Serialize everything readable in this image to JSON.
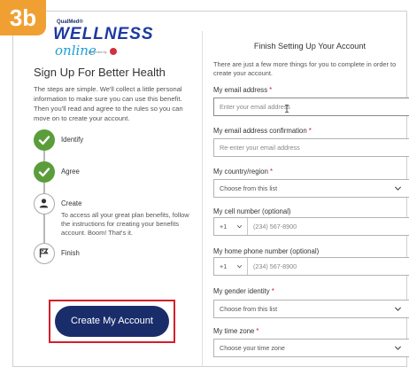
{
  "badge": "3b",
  "brand": {
    "top": "QualMed®",
    "main": "WELLNESS",
    "sub": "online",
    "powered": "powered by"
  },
  "left": {
    "title": "Sign Up For Better Health",
    "intro": "The steps are simple. We'll collect a little personal information to make sure you can use this benefit. Then you'll read and agree to the rules so you can move on to create your account.",
    "steps": [
      {
        "label": "Identify",
        "state": "done",
        "icon": "check-icon"
      },
      {
        "label": "Agree",
        "state": "done",
        "icon": "check-icon"
      },
      {
        "label": "Create",
        "state": "current",
        "icon": "user-icon",
        "desc": "To access all your great plan benefits, follow the instructions for creating your benefits account. Boom! That's it."
      },
      {
        "label": "Finish",
        "state": "pending",
        "icon": "flag-icon"
      }
    ],
    "cta": "Create My Account"
  },
  "right": {
    "title": "Finish Setting Up Your Account",
    "intro": "There are just a few more things for you to complete in order to create your account.",
    "fields": {
      "email": {
        "label": "My email address",
        "required": "*",
        "placeholder": "Enter your email address"
      },
      "email_confirm": {
        "label": "My email address confirmation",
        "required": "*",
        "placeholder": "Re-enter your email address"
      },
      "country": {
        "label": "My country/region",
        "required": "*",
        "value": "Choose from this list"
      },
      "cell": {
        "label": "My cell number (optional)",
        "code": "+1",
        "placeholder": "(234) 567-8900"
      },
      "home": {
        "label": "My home phone number (optional)",
        "code": "+1",
        "placeholder": "(234) 567-8900"
      },
      "gender": {
        "label": "My gender identity",
        "required": "*",
        "value": "Choose from this list"
      },
      "timezone": {
        "label": "My time zone",
        "required": "*",
        "value": "Choose your time zone"
      }
    }
  },
  "colors": {
    "badge": "#f0a033",
    "brand_navy": "#1d3aa0",
    "brand_blue": "#1d9fd8",
    "step_done": "#5a9d3a",
    "cta_bg": "#1a2d6b",
    "highlight": "#d31f2b"
  }
}
